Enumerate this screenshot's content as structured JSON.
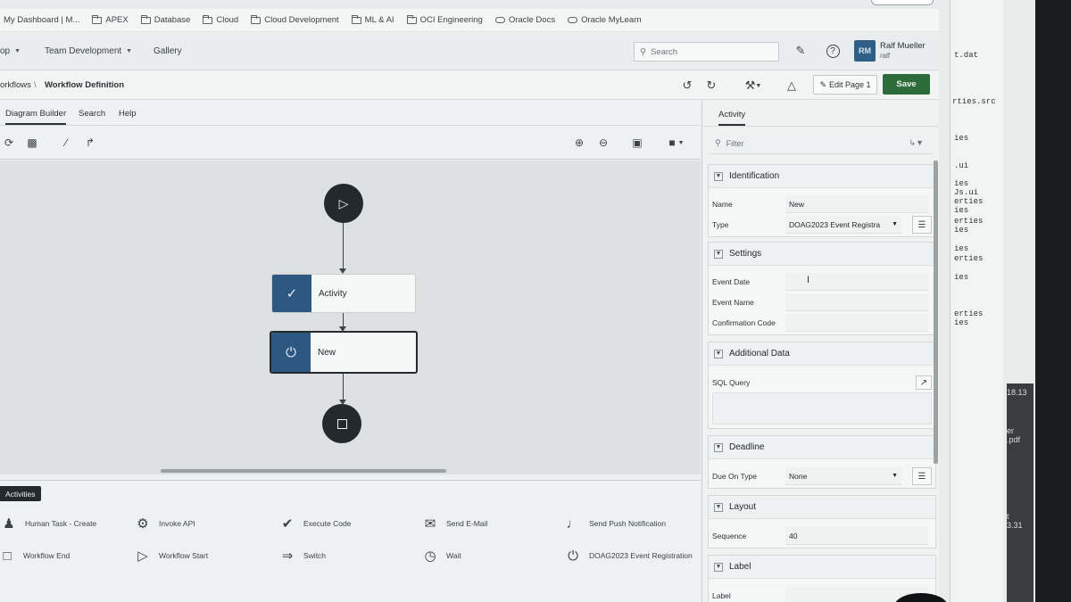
{
  "bookmarks": [
    "My Dashboard | M...",
    "APEX",
    "Database",
    "Cloud",
    "Cloud Development",
    "ML & AI",
    "OCI Engineering",
    "Oracle Docs",
    "Oracle MyLearn"
  ],
  "header": {
    "menu": [
      "op",
      "Team Development",
      "Gallery"
    ],
    "search_placeholder": "Search",
    "avatar_initials": "RM",
    "user_name": "Ralf Mueller",
    "user_id": "ralf"
  },
  "breadcrumb": {
    "parent": "orkflows",
    "current": "Workflow Definition"
  },
  "toolbar": {
    "edit_label": "Edit Page 1",
    "save_label": "Save"
  },
  "tabs": [
    "Diagram Builder",
    "Search",
    "Help"
  ],
  "diagram": {
    "nodes": [
      {
        "type": "start"
      },
      {
        "type": "activity",
        "label": "Activity"
      },
      {
        "type": "activity",
        "label": "New",
        "selected": true
      },
      {
        "type": "end"
      }
    ]
  },
  "palette": {
    "badge": "Activities",
    "items": [
      {
        "label": "Human Task - Create",
        "icon": "person-icon"
      },
      {
        "label": "Invoke API",
        "icon": "gear-api-icon"
      },
      {
        "label": "Execute Code",
        "icon": "check-circle-icon"
      },
      {
        "label": "Send E-Mail",
        "icon": "envelope-icon"
      },
      {
        "label": "Send Push Notification",
        "icon": "bell-icon"
      },
      {
        "label": "Workflow End",
        "icon": "stop-icon"
      },
      {
        "label": "Workflow Start",
        "icon": "play-icon"
      },
      {
        "label": "Switch",
        "icon": "switch-icon"
      },
      {
        "label": "Wait",
        "icon": "clock-icon"
      },
      {
        "label": "DOAG2023 Event Registration",
        "icon": "plug-icon"
      }
    ]
  },
  "panel": {
    "tab": "Activity",
    "filter_placeholder": "Filter",
    "identification": {
      "title": "Identification",
      "name_label": "Name",
      "name_value": "New",
      "type_label": "Type",
      "type_value": "DOAG2023 Event Registra"
    },
    "settings": {
      "title": "Settings",
      "event_date": "Event Date",
      "event_name": "Event Name",
      "confirmation_code": "Confirmation Code"
    },
    "additional": {
      "title": "Additional Data",
      "sql_query": "SQL Query"
    },
    "deadline": {
      "title": "Deadline",
      "due_on_type_label": "Due On Type",
      "due_on_type_value": "None"
    },
    "layout": {
      "title": "Layout",
      "sequence_label": "Sequence",
      "sequence_value": "40"
    },
    "label_section": {
      "title": "Label",
      "label_field": "Label"
    }
  },
  "background_window": {
    "mono_lines": [
      "t.dat",
      "rties.src",
      "ies",
      ".ui",
      "ies",
      "Js.ui",
      "erties",
      "ies",
      "erties",
      "ies",
      "ies",
      "erties",
      "ies",
      "erties",
      "ies"
    ],
    "dark_lines": [
      "18.13",
      "er",
      ".pdf",
      "t",
      "3.31"
    ]
  }
}
